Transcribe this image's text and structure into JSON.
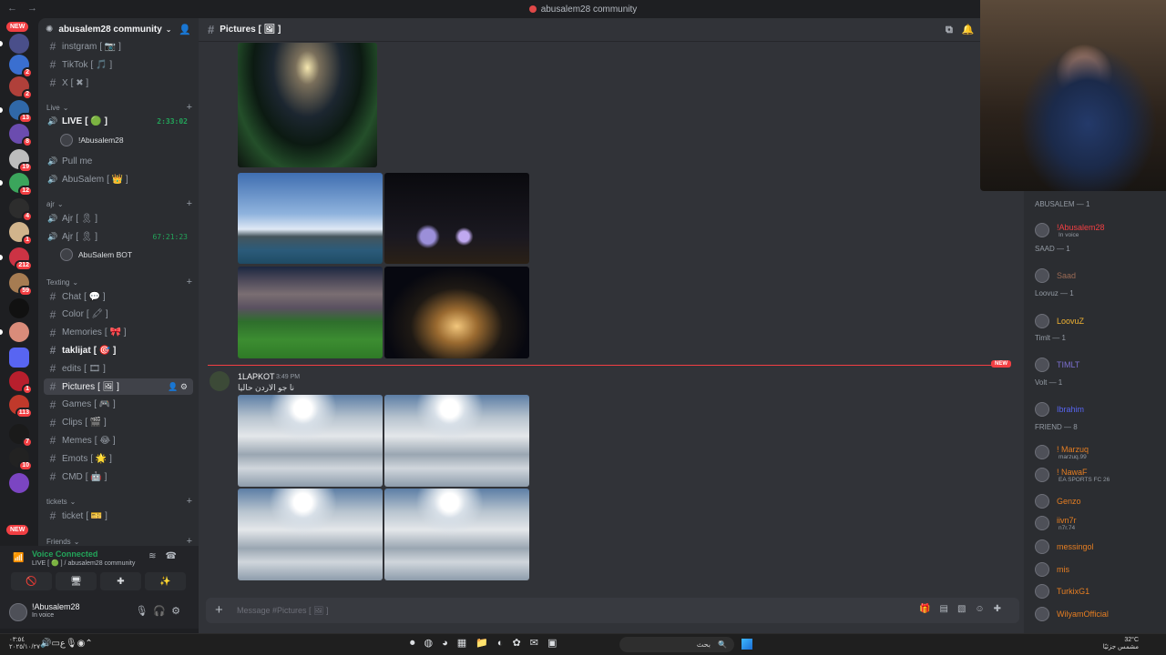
{
  "window_title": "abusalem28 community",
  "rail": {
    "new_top": "NEW",
    "new_bottom": "NEW",
    "servers": [
      {
        "badge": "",
        "color": "#4a4f8a"
      },
      {
        "badge": "2",
        "color": "#3a6fd0"
      },
      {
        "badge": "2",
        "color": "#b0403a"
      },
      {
        "badge": "13",
        "color": "#3068a8"
      },
      {
        "badge": "8",
        "color": "#6b4caf"
      },
      {
        "badge": "19",
        "color": "#bdbdbd"
      },
      {
        "badge": "12",
        "color": "#3ba55c"
      },
      {
        "badge": "4",
        "color": "#2d2d2d"
      },
      {
        "badge": "1",
        "color": "#d1b48c"
      },
      {
        "badge": "212",
        "color": "#cc3344"
      },
      {
        "badge": "59",
        "color": "#a67c52"
      },
      {
        "badge": "",
        "color": "#111111"
      },
      {
        "badge": "",
        "color": "#d98c7a"
      },
      {
        "badge": "",
        "color": "#5865f2"
      },
      {
        "badge": "1",
        "color": "#b81f2d"
      },
      {
        "badge": "113",
        "color": "#c0392b"
      },
      {
        "badge": "7",
        "color": "#1a1a1a"
      },
      {
        "badge": "10",
        "color": "#222222"
      },
      {
        "badge": "",
        "color": "#7b45c2"
      }
    ]
  },
  "guild": {
    "name": "abusalem28 community",
    "channels_top": [
      {
        "name": "instgram",
        "tail": "[ 📷 ]"
      },
      {
        "name": "TikTok",
        "tail": "[ 🎵 ]"
      },
      {
        "name": "X",
        "tail": "[ ✖ ]"
      }
    ],
    "cat_live": "Live",
    "live_channels": [
      {
        "name": "LIVE",
        "tail": "[ 🟢 ]",
        "duration": "2:33:02"
      },
      {
        "name": "Pull me",
        "tail": ""
      },
      {
        "name": "AbuSalem",
        "tail": "[ 👑 ]"
      }
    ],
    "live_user": "!Abusalem28",
    "cat_ajr": "ajr",
    "ajr_channels": [
      {
        "name": "Ajr",
        "tail": "[ 🎗 ]",
        "duration": ""
      },
      {
        "name": "Ajr",
        "tail": "[ 🎗 ]",
        "duration": "67:21:23"
      }
    ],
    "ajr_user": "AbuSalem BOT",
    "cat_texting": "Texting",
    "text_channels": [
      {
        "name": "Chat",
        "tail": "[ 💬 ]"
      },
      {
        "name": "Color",
        "tail": "[ 🖍 ]"
      },
      {
        "name": "Memories",
        "tail": "[ 🎀 ]"
      },
      {
        "name": "taklijat",
        "tail": "[ 🎯 ]"
      },
      {
        "name": "edits",
        "tail": "[ 🎞 ]"
      },
      {
        "name": "Pictures",
        "tail": "[ 🖼 ]"
      },
      {
        "name": "Games",
        "tail": "[ 🎮 ]"
      },
      {
        "name": "Clips",
        "tail": "[ 🎬 ]"
      },
      {
        "name": "Memes",
        "tail": "[ 😂 ]"
      },
      {
        "name": "Emots",
        "tail": "[ 🌟 ]"
      },
      {
        "name": "CMD",
        "tail": "[ 🤖 ]"
      }
    ],
    "cat_tickets": "tickets",
    "ticket_channel": {
      "name": "ticket",
      "tail": "[ 🎫 ]"
    },
    "cat_friends": "Friends"
  },
  "voice": {
    "status": "Voice Connected",
    "sub": "LIVE [ 🟢 ] / abusalem28 community"
  },
  "user": {
    "name": "!Abusalem28",
    "status": "In voice"
  },
  "channel": {
    "title": "Pictures [ 🖼 ]"
  },
  "message": {
    "author": "1LAPKOT",
    "time": "3:49 PM",
    "text": "نا جو الاردن حاليا",
    "new_tag": "NEW"
  },
  "composer": {
    "placeholder": "Message #Pictures [ 🖼 ]"
  },
  "members": {
    "groups": [
      {
        "label": "ABUSALEM — 1",
        "items": [
          {
            "name": "!Abusalem28",
            "sub": "In voice",
            "color": "#f23f43"
          }
        ]
      },
      {
        "label": "SAAD — 1",
        "items": [
          {
            "name": "Saad",
            "sub": "",
            "color": "#9a6a55"
          }
        ]
      },
      {
        "label": "Loovuz — 1",
        "items": [
          {
            "name": "LoovuZ",
            "sub": "",
            "color": "#f0b232"
          }
        ]
      },
      {
        "label": "Timlt — 1",
        "items": [
          {
            "name": "TIMLT",
            "sub": "",
            "color": "#7b6fd0"
          }
        ]
      },
      {
        "label": "Volt — 1",
        "items": [
          {
            "name": "Ibrahim",
            "sub": "",
            "color": "#5865f2"
          }
        ]
      },
      {
        "label": "FRIEND — 8",
        "items": [
          {
            "name": "! Marzuq",
            "sub": "marzuq.99",
            "color": "#e67e22"
          },
          {
            "name": "! NawaF",
            "sub": "EA SPORTS FC 26",
            "color": "#e67e22"
          },
          {
            "name": "Genzo",
            "sub": "",
            "color": "#e67e22"
          },
          {
            "name": "iivn7r",
            "sub": "n7r.74",
            "color": "#e67e22"
          },
          {
            "name": "messingol",
            "sub": "",
            "color": "#e67e22"
          },
          {
            "name": "mis",
            "sub": "",
            "color": "#e67e22"
          },
          {
            "name": "TurkixG1",
            "sub": "",
            "color": "#e67e22"
          },
          {
            "name": "WilyamOfficial",
            "sub": "",
            "color": "#e67e22"
          }
        ]
      }
    ]
  },
  "taskbar": {
    "time": "٠٣:٥٤",
    "date": "٢٠٢٥/١٠/٢٧",
    "search": "بحث",
    "temp": "32°C",
    "weather": "مشمس جزئيًا"
  }
}
